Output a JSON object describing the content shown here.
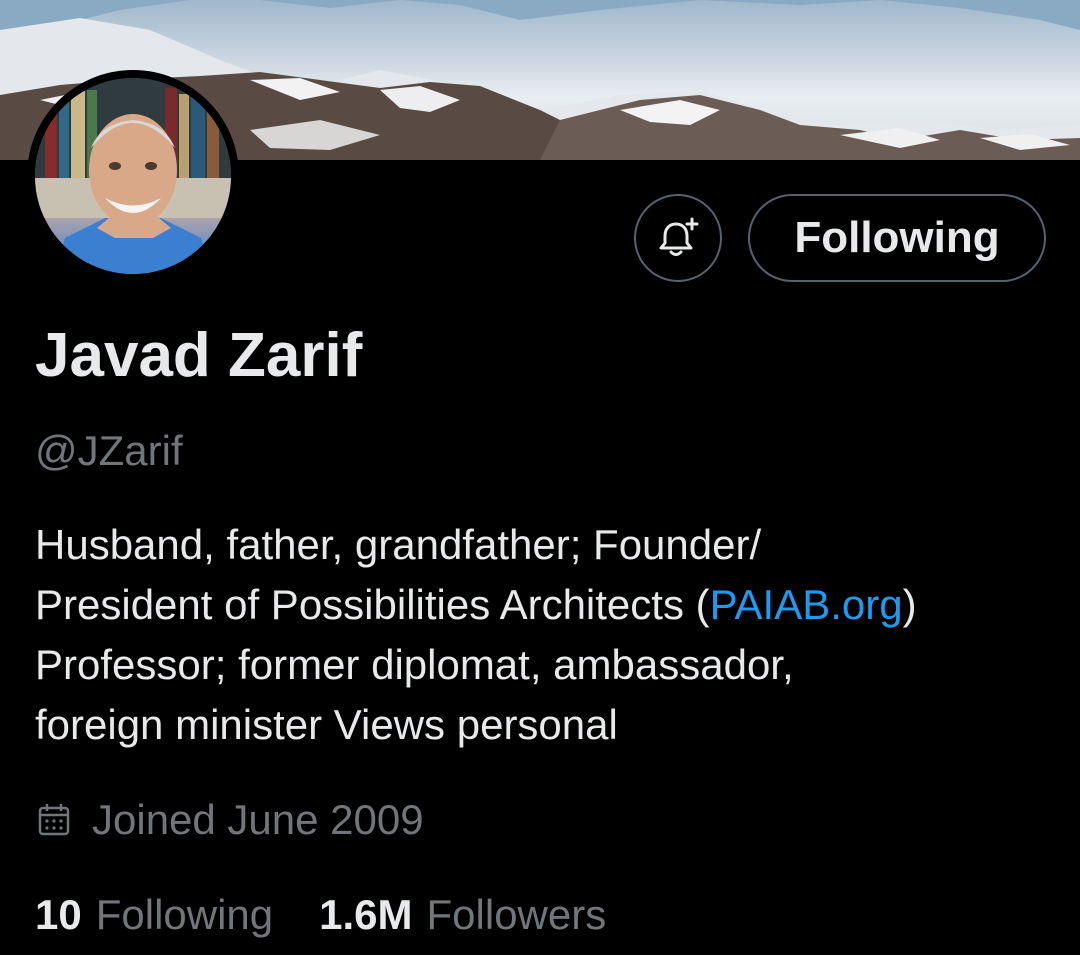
{
  "profile": {
    "display_name": "Javad Zarif",
    "handle": "@JZarif",
    "bio_lines": [
      "Husband, father, grandfather;  Founder/",
      "President of Possibilities Architects (",
      "PAIAB.org",
      ")",
      "Professor; former diplomat, ambassador,",
      "foreign minister Views personal"
    ],
    "joined": "Joined June 2009",
    "following_count": "10",
    "following_label": "Following",
    "followers_count": "1.6M",
    "followers_label": "Followers"
  },
  "actions": {
    "follow_state_label": "Following",
    "notify_icon": "bell-plus-icon"
  },
  "icons": {
    "joined_icon": "calendar-icon"
  },
  "colors": {
    "background": "#000000",
    "text": "#e7e9ea",
    "secondary": "#71767b",
    "link": "#1d9bf0",
    "border": "#536471"
  }
}
